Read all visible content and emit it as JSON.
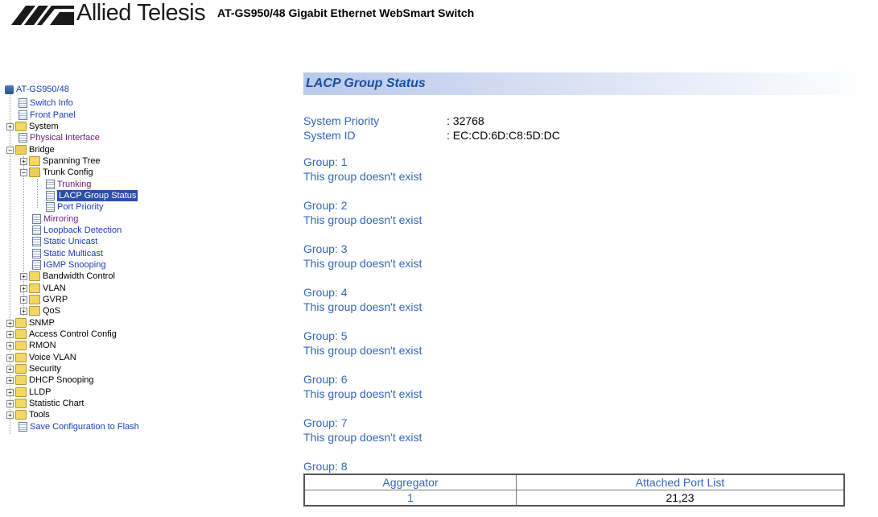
{
  "header": {
    "brand": "Allied Telesis",
    "product_title": "AT-GS950/48 Gigabit Ethernet WebSmart Switch"
  },
  "tree": {
    "root": "AT-GS950/48",
    "items": [
      {
        "label": "Switch Info"
      },
      {
        "label": "Front Panel"
      },
      {
        "label": "System"
      },
      {
        "label": "Physical Interface"
      },
      {
        "label": "Bridge"
      },
      {
        "label": "Spanning Tree"
      },
      {
        "label": "Trunk Config"
      },
      {
        "label": "Trunking"
      },
      {
        "label": "LACP Group Status"
      },
      {
        "label": "Port Priority"
      },
      {
        "label": "Mirroring"
      },
      {
        "label": "Loopback Detection"
      },
      {
        "label": "Static Unicast"
      },
      {
        "label": "Static Multicast"
      },
      {
        "label": "IGMP Snooping"
      },
      {
        "label": "Bandwidth Control"
      },
      {
        "label": "VLAN"
      },
      {
        "label": "GVRP"
      },
      {
        "label": "QoS"
      },
      {
        "label": "SNMP"
      },
      {
        "label": "Access Control Config"
      },
      {
        "label": "RMON"
      },
      {
        "label": "Voice VLAN"
      },
      {
        "label": "Security"
      },
      {
        "label": "DHCP Snooping"
      },
      {
        "label": "LLDP"
      },
      {
        "label": "Statistic Chart"
      },
      {
        "label": "Tools"
      },
      {
        "label": "Save Configuration to Flash"
      }
    ]
  },
  "main": {
    "title": "LACP Group Status",
    "system_priority_label": "System Priority",
    "system_priority_value": ": 32768",
    "system_id_label": "System ID",
    "system_id_value": ": EC:CD:6D:C8:5D:DC",
    "groups": [
      {
        "label": "Group: 1",
        "status": "This group doesn't exist"
      },
      {
        "label": "Group: 2",
        "status": "This group doesn't exist"
      },
      {
        "label": "Group: 3",
        "status": "This group doesn't exist"
      },
      {
        "label": "Group: 4",
        "status": "This group doesn't exist"
      },
      {
        "label": "Group: 5",
        "status": "This group doesn't exist"
      },
      {
        "label": "Group: 6",
        "status": "This group doesn't exist"
      },
      {
        "label": "Group: 7",
        "status": "This group doesn't exist"
      },
      {
        "label": "Group: 8",
        "status": ""
      }
    ],
    "table": {
      "headers": [
        "Aggregator",
        "Attached Port List"
      ],
      "rows": [
        [
          "1",
          "21,23"
        ]
      ]
    }
  }
}
